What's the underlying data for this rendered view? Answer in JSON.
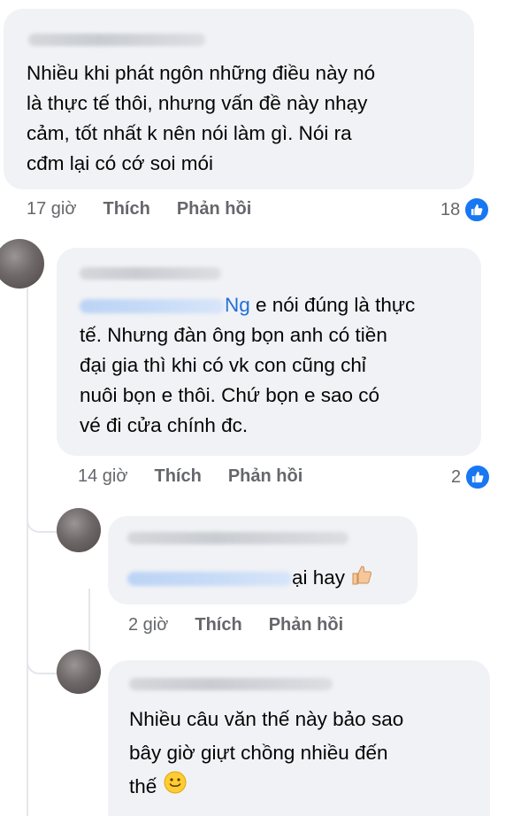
{
  "comments": [
    {
      "text": "Nhiều khi phát ngôn những điều này nó\nlà thực tế thôi, nhưng vấn đề này nhạy\ncảm, tốt nhất k nên nói làm gì. Nói ra\ncđm lại có cớ soi mói",
      "time": "17 giờ",
      "like_label": "Thích",
      "reply_label": "Phản hồi",
      "reaction_count": "18",
      "reaction_icon": "like-icon"
    },
    {
      "mention_tail": "Ng",
      "text_first": " e nói đúng là thực",
      "text_rest": "tế. Nhưng đàn ông bọn anh có tiền\nđại gia thì khi có vk con cũng chỉ\nnuôi bọn e thôi. Chứ bọn e sao có\nvé đi cửa chính đc.",
      "time": "14 giờ",
      "like_label": "Thích",
      "reply_label": "Phản hồi",
      "reaction_count": "2",
      "reaction_icon": "like-icon"
    },
    {
      "text": "ại hay",
      "emoji": "thumbs-up-emoji",
      "time": "2 giờ",
      "like_label": "Thích",
      "reply_label": "Phản hồi"
    },
    {
      "text": "Nhiều câu văn thế này bảo sao\nbây giờ giựt chồng nhiều đến\nthế",
      "emoji": "smiley-emoji"
    }
  ],
  "colors": {
    "bubble": "#f0f2f5",
    "text": "#050505",
    "meta": "#65676b",
    "mention": "#216fdb",
    "like": "#1877f2"
  }
}
